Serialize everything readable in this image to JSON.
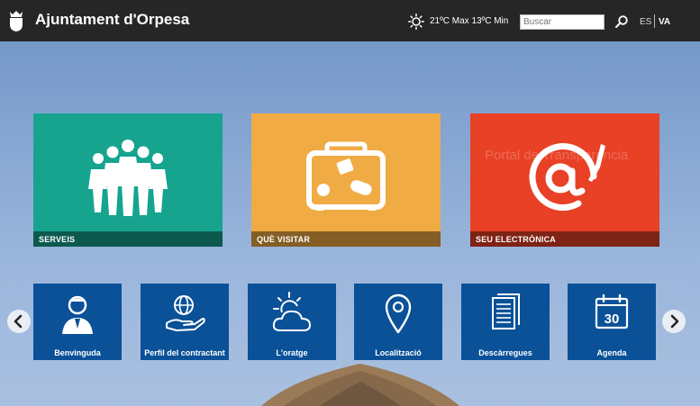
{
  "header": {
    "site_title": "Ajuntament d'Orpesa",
    "weather": "21ºC Max 13ºC Min",
    "search_placeholder": "Buscar",
    "lang_es": "ES",
    "lang_va": "VA"
  },
  "featured": [
    {
      "label": "SERVEIS",
      "icon": "people-group-icon",
      "color": "#16a48f"
    },
    {
      "label": "QUÈ VISITAR",
      "icon": "suitcase-icon",
      "color": "#f0ab44"
    },
    {
      "label": "SEU ELECTRÒNICA",
      "icon": "at-sign-pen-icon",
      "color": "#e84125"
    }
  ],
  "background_text": {
    "portal": "Portal de Transparencia"
  },
  "shortcuts": [
    {
      "label": "Benvinguda",
      "icon": "person-icon"
    },
    {
      "label": "Perfil del contractant",
      "icon": "globe-hand-icon"
    },
    {
      "label": "L'oratge",
      "icon": "sun-cloud-icon"
    },
    {
      "label": "Localització",
      "icon": "map-pin-icon"
    },
    {
      "label": "Descàrregues",
      "icon": "documents-icon"
    },
    {
      "label": "Agenda",
      "icon": "calendar-icon",
      "day": "30"
    }
  ],
  "colors": {
    "header_bg": "#262626",
    "shortcut_tile": "#0a5198"
  }
}
